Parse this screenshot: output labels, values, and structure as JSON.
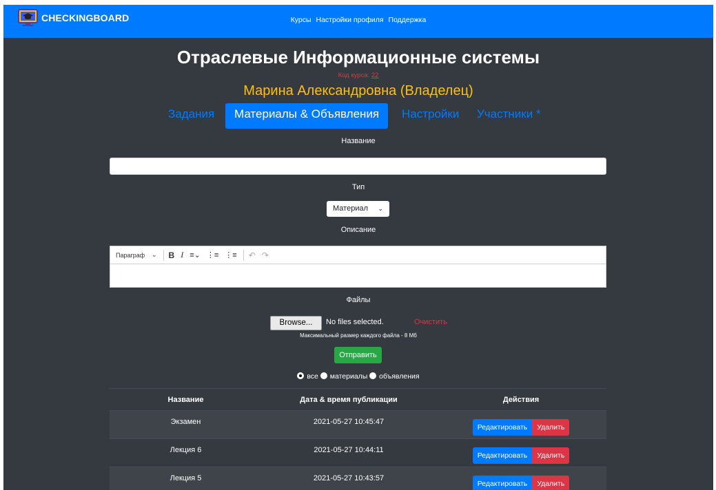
{
  "navbar": {
    "brand": "CHECKINGBOARD",
    "links": [
      "Курсы",
      "Настройки профиля",
      "Поддержка"
    ],
    "color": "#007bff"
  },
  "course": {
    "title": "Отраслевые Информационные системы",
    "code_label": "Код курса:",
    "code_value": "22",
    "owner": "Марина Александровна (Владелец)"
  },
  "tabs": [
    {
      "label": "Задания",
      "active": false
    },
    {
      "label": "Материалы & Объявления",
      "active": true
    },
    {
      "label": "Настройки",
      "active": false
    },
    {
      "label": "Участники *",
      "active": false
    }
  ],
  "form": {
    "name_label": "Название",
    "name_value": "",
    "type_label": "Тип",
    "type_selected": "Материал",
    "description_label": "Описание",
    "editor": {
      "paragraph_select": "Параграф",
      "icons": [
        "bold-icon",
        "italic-icon",
        "align-icon",
        "bulleted-list-icon",
        "numbered-list-icon",
        "undo-icon",
        "redo-icon"
      ]
    },
    "files_label": "Файлы",
    "browse_label": "Browse...",
    "no_files": "No files selected.",
    "clear_label": "Очистить",
    "max_size": "Максимальный размер каждого файла - 8 Мб",
    "submit_label": "Отправить"
  },
  "filters": {
    "options": [
      "все",
      "материалы",
      "объявления"
    ],
    "selected": "все"
  },
  "table": {
    "headers": [
      "Название",
      "Дата & время публикации",
      "Действия"
    ],
    "rows": [
      {
        "name": "Экзамен",
        "datetime": "2021-05-27 10:45:47"
      },
      {
        "name": "Лекция 6",
        "datetime": "2021-05-27 10:44:11"
      },
      {
        "name": "Лекция 5",
        "datetime": "2021-05-27 10:43:57"
      }
    ],
    "edit_label": "Редактировать",
    "delete_label": "Удалить"
  }
}
